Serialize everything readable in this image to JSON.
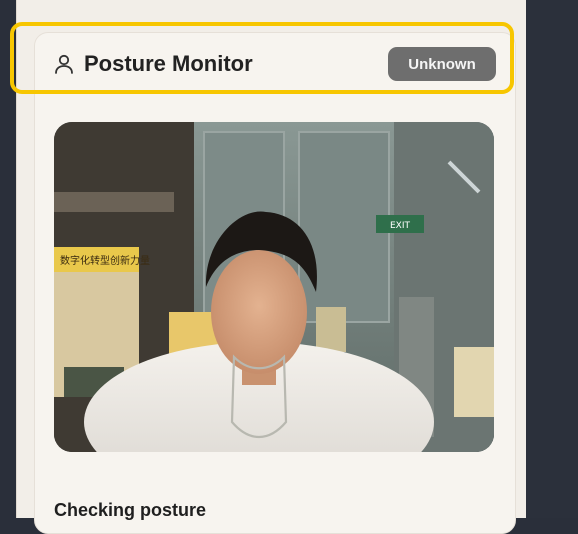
{
  "header": {
    "title": "Posture Monitor",
    "status_badge": "Unknown"
  },
  "camera": {
    "sign_text": "数字化转型创新力量",
    "exit_sign_text": "EXIT"
  },
  "posture": {
    "checking_text": "Checking posture"
  },
  "colors": {
    "highlight": "#f7c600",
    "badge": "#6e6e6e"
  }
}
